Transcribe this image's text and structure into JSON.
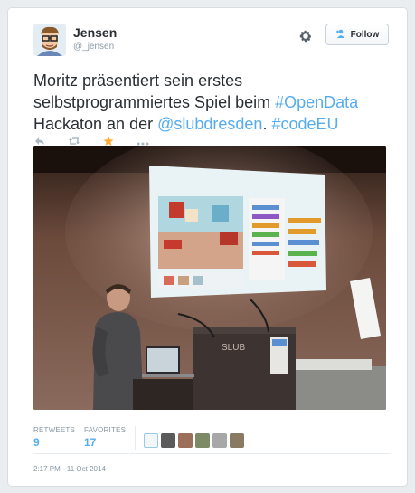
{
  "user": {
    "full_name": "Jensen",
    "screen_name": "@_jensen"
  },
  "follow_label": "Follow",
  "tweet": {
    "text_1": "Moritz präsentiert sein erstes selbstprogrammiertes Spiel beim ",
    "hashtag_1": "#OpenData",
    "text_2": " Hackaton an der ",
    "mention_1": "@slubdresden",
    "text_3": ". ",
    "hashtag_2": "#codeEU"
  },
  "photo_caption": {
    "podium_label": "SLUB"
  },
  "stats": {
    "retweets_label": "RETWEETS",
    "retweets_count": "9",
    "favorites_label": "FAVORITES",
    "favorites_count": "17"
  },
  "timestamp": "2:17 PM - 11 Oct 2014",
  "colors": {
    "link": "#55acee",
    "favorite": "#ffac33",
    "muted": "#8899a6"
  },
  "icons": [
    "settings-gear-icon",
    "add-user-icon",
    "reply-icon",
    "retweet-icon",
    "favorite-star-icon",
    "more-icon"
  ]
}
